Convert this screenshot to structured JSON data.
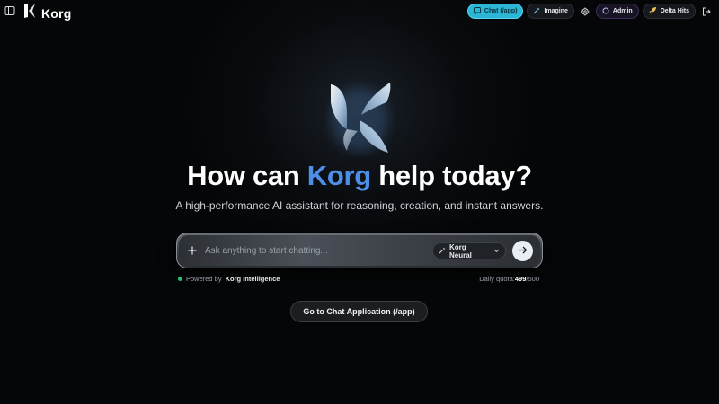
{
  "brand": {
    "name": "Korg",
    "icon": "korg-k-logo"
  },
  "nav": {
    "chat_label": "Chat (/app)",
    "imagine_label": "Imagine",
    "admin_label": "Admin",
    "delta_label": "Delta Hits",
    "icons": {
      "sidebar": "sidebar-toggle-icon",
      "chat": "chat-bubble-icon",
      "imagine": "sparkle-wand-icon",
      "settings": "gear-icon",
      "admin": "ring-icon",
      "delta": "rocket-icon",
      "logout": "logout-icon"
    }
  },
  "hero": {
    "title_prefix": "How can ",
    "title_accent": "Korg",
    "title_suffix": " help today?",
    "subtitle": "A high-performance AI assistant for reasoning, creation, and instant answers."
  },
  "chat": {
    "placeholder": "Ask anything to start chatting...",
    "model_label": "Korg Neural",
    "icons": {
      "attach": "plus-icon",
      "model": "sparkle-icon",
      "dropdown": "chevron-down-icon",
      "send": "arrow-right-icon"
    }
  },
  "footer": {
    "powered_prefix": "Powered by",
    "powered_brand": "Korg Intelligence",
    "quota_label": "Daily quota: ",
    "quota_used": "499",
    "quota_total": "/500"
  },
  "cta": {
    "label": "Go to Chat Application (/app)"
  },
  "colors": {
    "accent": "#4d8fe6",
    "active_nav": "#2bb6d6",
    "status": "#25c26b",
    "background": "#050607"
  }
}
